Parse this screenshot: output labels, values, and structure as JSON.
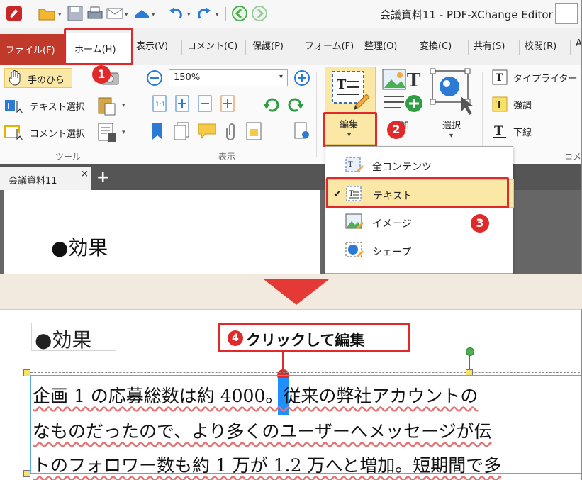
{
  "window": {
    "title": "会議資料11 - PDF-XChange Editor"
  },
  "tabs": [
    {
      "label": "ファイル(F)"
    },
    {
      "label": "ホーム(H)"
    },
    {
      "label": "表示(V)"
    },
    {
      "label": "コメント(C)"
    },
    {
      "label": "保護(P)"
    },
    {
      "label": "フォーム(F)"
    },
    {
      "label": "整理(O)"
    },
    {
      "label": "変換(C)"
    },
    {
      "label": "共有(S)"
    },
    {
      "label": "校閲(R)"
    },
    {
      "label": "A"
    }
  ],
  "ribbon": {
    "tools": {
      "hand": "手のひら",
      "select_text": "テキスト選択",
      "select_comment": "コメント選択",
      "group_label": "ツール"
    },
    "view": {
      "zoom_value": "150%",
      "group_label": "表示"
    },
    "objects": {
      "edit_label": "編集",
      "add_label": "加",
      "select_label": "選択"
    },
    "comment": {
      "typewriter": "タイプライター",
      "highlight": "強調",
      "underline": "下線",
      "group_label": "コメ"
    }
  },
  "edit_menu": {
    "items": [
      {
        "label": "全コンテンツ",
        "checked": false
      },
      {
        "label": "テキスト",
        "checked": true
      },
      {
        "label": "イメージ",
        "checked": false
      },
      {
        "label": "シェープ",
        "checked": false
      }
    ]
  },
  "document_tab": {
    "label": "会議資料11",
    "close": "×",
    "add": "+"
  },
  "page_top": {
    "heading": "●効果"
  },
  "badges": {
    "b1": "1",
    "b2": "2",
    "b3": "3",
    "b4": "4"
  },
  "after": {
    "heading": "●効果",
    "callout": "クリックして編集",
    "lines": [
      "企画 1 の応募総数は約 4000。従来の弊社アカウントの",
      "なものだったので、より多くのユーザーへメッセージが伝",
      "トのフォロワー数も約 1 万が 1.2 万へと増加。短期間で多"
    ]
  },
  "colors": {
    "accent_red": "#e02a2a",
    "file_tab": "#c0392b",
    "selection_blue": "#1e90ff",
    "menu_highlight": "#fbe8a6"
  }
}
